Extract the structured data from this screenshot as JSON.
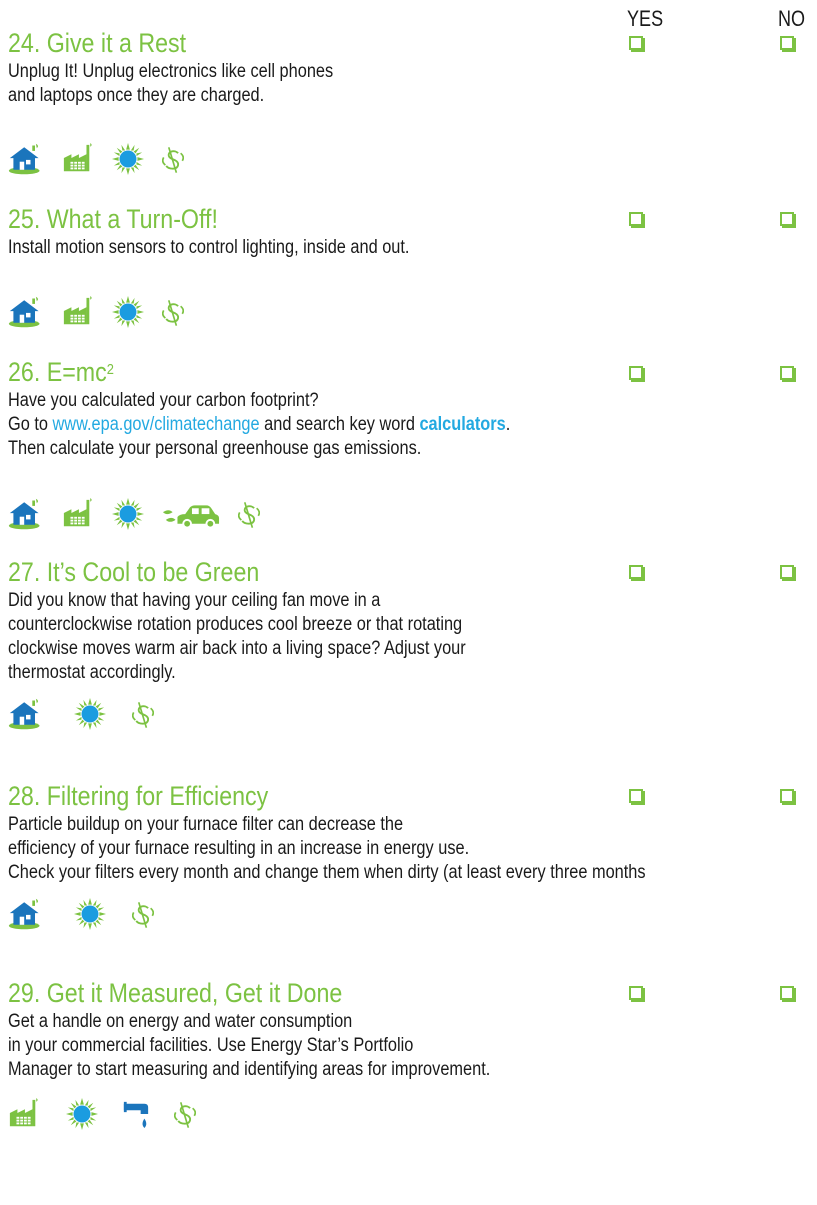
{
  "columns": {
    "yes": "YES",
    "no": "NO"
  },
  "colors": {
    "green": "#7cc242",
    "blue": "#1b75bc",
    "sky": "#23a9e1"
  },
  "items": [
    {
      "title": "24. Give it a Rest",
      "lines": [
        "Unplug It! Unplug electronics like cell phones",
        "and laptops once they are charged."
      ],
      "icons": [
        "house-icon",
        "factory-icon",
        "sun-icon",
        "dollar-icon"
      ]
    },
    {
      "title": "25. What a Turn-Off!",
      "lines": [
        "Install motion sensors to control lighting, inside and out."
      ],
      "icons": [
        "house-icon",
        "factory-icon",
        "sun-icon",
        "dollar-icon"
      ]
    },
    {
      "title_pre": "26. E=mc",
      "title_sup": "2",
      "line1": "Have you calculated your carbon footprint?",
      "line2_pre": "Go to ",
      "line2_link": "www.epa.gov/climatechange",
      "line2_mid": " and search key word ",
      "line2_bold": "calculators",
      "line2_post": ".",
      "line3": "Then calculate your personal greenhouse gas emissions.",
      "icons": [
        "house-icon",
        "factory-icon",
        "sun-icon",
        "car-icon",
        "dollar-icon"
      ]
    },
    {
      "title": "27. It’s Cool to be Green",
      "lines": [
        "Did you know that having your ceiling fan move in a",
        "counterclockwise rotation produces cool breeze or that rotating",
        "clockwise moves warm air back into a living space? Adjust your",
        "thermostat accordingly."
      ],
      "icons": [
        "house-icon",
        "sun-icon",
        "dollar-icon"
      ]
    },
    {
      "title": "28. Filtering for Efficiency",
      "lines": [
        "Particle buildup on your furnace filter can decrease the",
        "efficiency of your furnace resulting in an increase in energy use.",
        "Check your filters every month and change them when dirty (at least every three months"
      ],
      "icons": [
        "house-icon",
        "sun-icon",
        "dollar-icon"
      ]
    },
    {
      "title": "29. Get it Measured, Get it Done",
      "lines": [
        "Get a handle on energy and water consumption",
        "in your commercial facilities. Use Energy Star’s Portfolio",
        "Manager to start measuring and identifying areas for improvement."
      ],
      "icons": [
        "factory-icon",
        "sun-icon",
        "faucet-icon",
        "dollar-icon"
      ]
    }
  ]
}
